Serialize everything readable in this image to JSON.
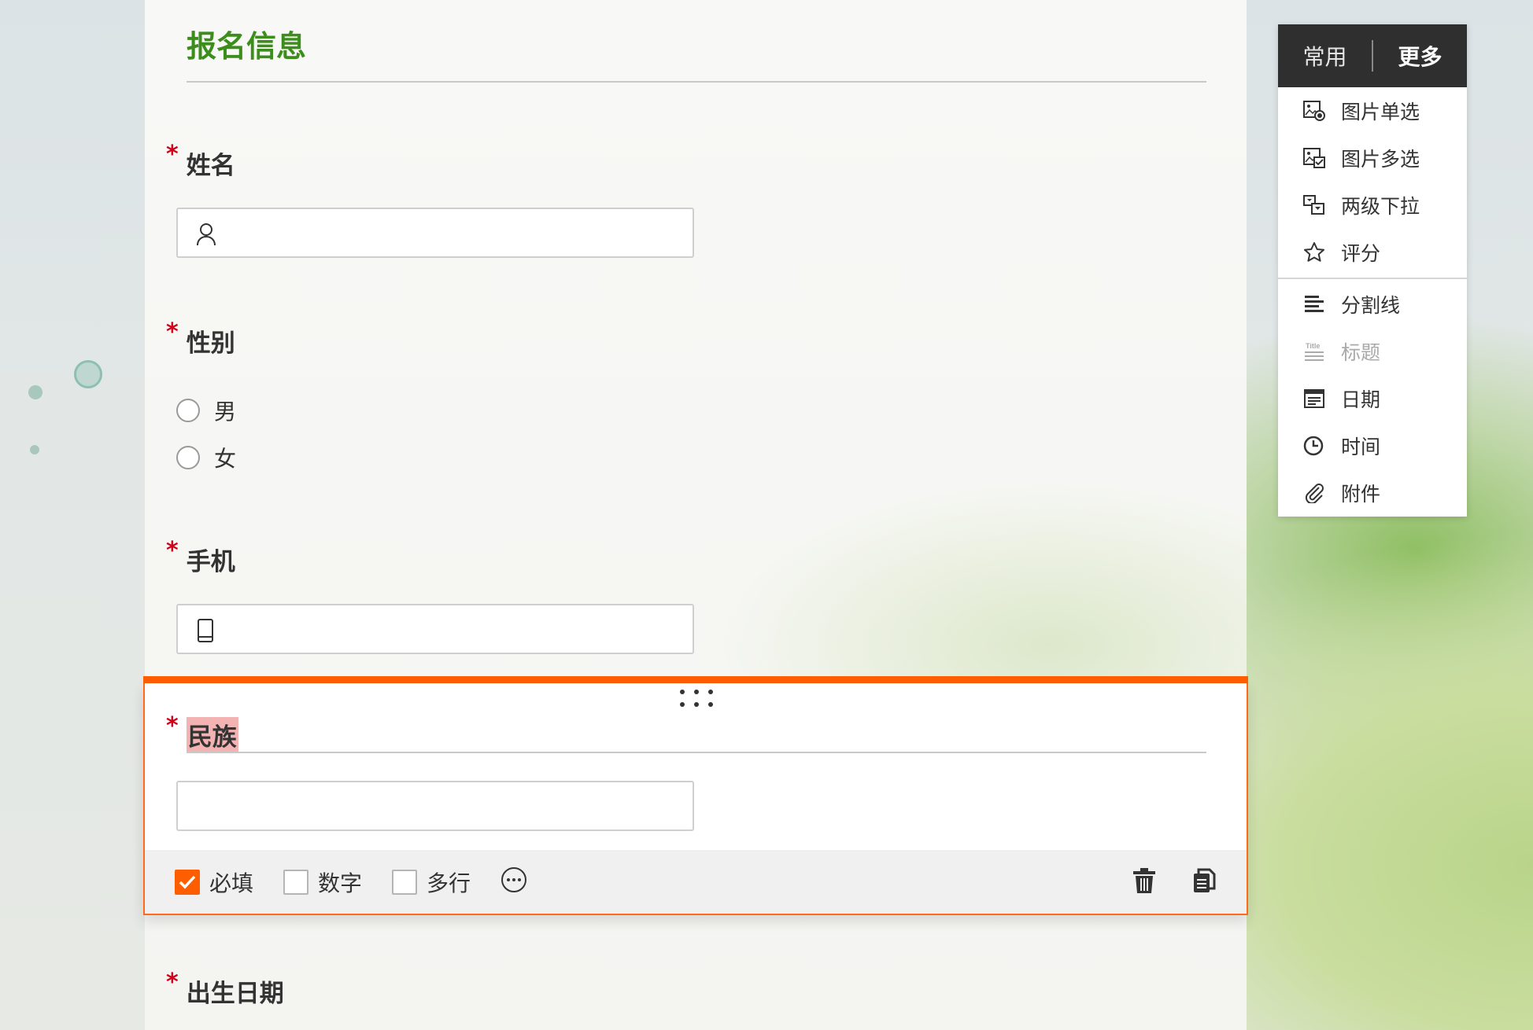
{
  "form": {
    "section_title": "报名信息",
    "fields": [
      {
        "label": "姓名",
        "required_mark": "*"
      },
      {
        "label": "性别",
        "required_mark": "*",
        "options": [
          "男",
          "女"
        ]
      },
      {
        "label": "手机",
        "required_mark": "*"
      },
      {
        "label": "民族",
        "required_mark": "*"
      },
      {
        "label": "出生日期",
        "required_mark": "*"
      }
    ]
  },
  "selected_toolbar": {
    "required_label": "必填",
    "required_checked": true,
    "number_label": "数字",
    "multiline_label": "多行"
  },
  "menu": {
    "tabs": [
      "常用",
      "更多"
    ],
    "active_tab": "更多",
    "items": [
      {
        "label": "图片单选",
        "icon": "image-radio-icon"
      },
      {
        "label": "图片多选",
        "icon": "image-checkbox-icon"
      },
      {
        "label": "两级下拉",
        "icon": "cascade-dropdown-icon"
      },
      {
        "label": "评分",
        "icon": "star-icon"
      },
      {
        "label": "分割线",
        "icon": "divider-icon"
      },
      {
        "label": "标题",
        "icon": "title-icon",
        "disabled": true
      },
      {
        "label": "日期",
        "icon": "calendar-icon"
      },
      {
        "label": "时间",
        "icon": "clock-icon"
      },
      {
        "label": "附件",
        "icon": "paperclip-icon"
      }
    ]
  },
  "colors": {
    "title_green": "#3c8d1c",
    "accent_orange": "#ff5e00",
    "required_red": "#d0021b",
    "menu_header": "#2f2f2f"
  }
}
